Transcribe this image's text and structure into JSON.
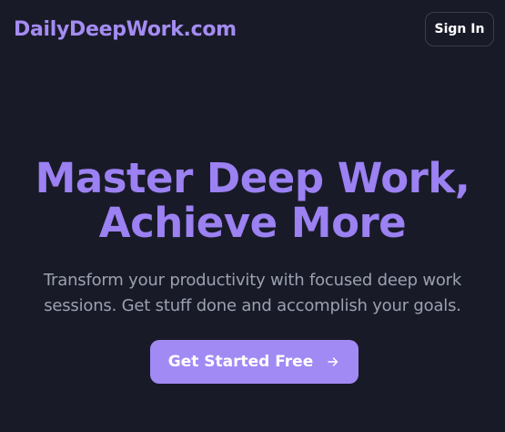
{
  "header": {
    "brand": "DailyDeepWork.com",
    "sign_in_label": "Sign In"
  },
  "hero": {
    "title_line1": "Master Deep Work,",
    "title_line2": "Achieve More",
    "subtitle_line1": "Transform your productivity with focused deep work",
    "subtitle_line2": "sessions. Get stuff done and accomplish your goals.",
    "cta_label": "Get Started Free",
    "cta_icon": "arrow-right-icon"
  },
  "colors": {
    "background": "#191a28",
    "accent": "#9b81f2",
    "button": "#a18af4",
    "subtitle": "#9aa1b0"
  }
}
